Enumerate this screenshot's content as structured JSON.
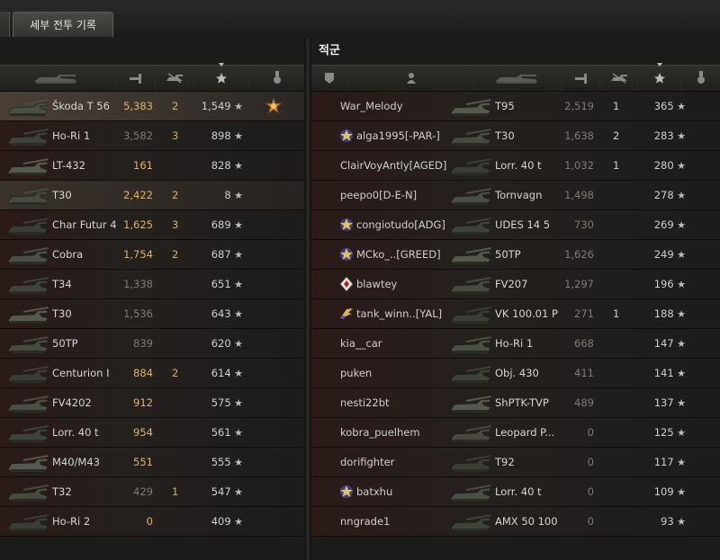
{
  "tab": {
    "label": "세부 전투 기록"
  },
  "enemy_title": "적군",
  "colors": {
    "xp": "#e0b46a",
    "dim": "#7c7c77",
    "text": "#d6d6d0"
  },
  "left_rows": [
    {
      "tank": "Škoda T 56",
      "xp": "5,383",
      "kills": "2",
      "score": "1,549",
      "xp_color": "gold",
      "medal": true,
      "hl": "hl"
    },
    {
      "tank": "Ho-Ri 1",
      "xp": "3,582",
      "kills": "3",
      "score": "898",
      "xp_color": "dim"
    },
    {
      "tank": "LT-432",
      "xp": "161",
      "kills": "",
      "score": "828",
      "xp_color": "gold"
    },
    {
      "tank": "T30",
      "xp": "2,422",
      "kills": "2",
      "score": "8",
      "xp_color": "gold",
      "hl": "hl2"
    },
    {
      "tank": "Char Futur 4",
      "xp": "1,625",
      "kills": "3",
      "score": "689",
      "xp_color": "gold"
    },
    {
      "tank": "Cobra",
      "xp": "1,754",
      "kills": "2",
      "score": "687",
      "xp_color": "gold"
    },
    {
      "tank": "T34",
      "xp": "1,338",
      "kills": "",
      "score": "651",
      "xp_color": "dim"
    },
    {
      "tank": "T30",
      "xp": "1,536",
      "kills": "",
      "score": "643",
      "xp_color": "dim"
    },
    {
      "tank": "50TP",
      "xp": "839",
      "kills": "",
      "score": "620",
      "xp_color": "dim"
    },
    {
      "tank": "Centurion I",
      "xp": "884",
      "kills": "2",
      "score": "614",
      "xp_color": "gold"
    },
    {
      "tank": "FV4202",
      "xp": "912",
      "kills": "",
      "score": "575",
      "xp_color": "gold"
    },
    {
      "tank": "Lorr. 40 t",
      "xp": "954",
      "kills": "",
      "score": "561",
      "xp_color": "gold"
    },
    {
      "tank": "M40/M43",
      "xp": "551",
      "kills": "",
      "score": "555",
      "xp_color": "gold"
    },
    {
      "tank": "T32",
      "xp": "429",
      "kills": "1",
      "score": "547",
      "xp_color": "dim"
    },
    {
      "tank": "Ho-Ri 2",
      "xp": "0",
      "kills": "",
      "score": "409",
      "xp_color": "gold"
    }
  ],
  "right_rows": [
    {
      "player": "War_Melody",
      "badge": "",
      "tank": "T95",
      "xp": "2,519",
      "kills": "1",
      "score": "365"
    },
    {
      "player": "alga1995[-PAR-]",
      "badge": "clan-badge",
      "tank": "T30",
      "xp": "1,638",
      "kills": "2",
      "score": "283"
    },
    {
      "player": "ClairVoyAntly[AGED]",
      "badge": "",
      "tank": "Lorr. 40 t",
      "xp": "1,032",
      "kills": "1",
      "score": "280"
    },
    {
      "player": "peepo0[D-E-N]",
      "badge": "",
      "tank": "Tornvagn",
      "xp": "1,498",
      "kills": "",
      "score": "278"
    },
    {
      "player": "congiotudo[ADG]",
      "badge": "clan-badge",
      "tank": "UDES 14 5",
      "xp": "730",
      "kills": "",
      "score": "269"
    },
    {
      "player": "MCko_..[GREED]",
      "badge": "clan-badge",
      "tank": "50TP",
      "xp": "1,626",
      "kills": "",
      "score": "249"
    },
    {
      "player": "blawtey",
      "badge": "rank-badge",
      "tank": "FV207",
      "xp": "1,297",
      "kills": "",
      "score": "196"
    },
    {
      "player": "tank_winn..[YAL]",
      "badge": "wing-badge",
      "tank": "VK 100.01 P",
      "xp": "271",
      "kills": "1",
      "score": "188"
    },
    {
      "player": "kia__car",
      "badge": "",
      "tank": "Ho-Ri 1",
      "xp": "668",
      "kills": "",
      "score": "147"
    },
    {
      "player": "puken",
      "badge": "",
      "tank": "Obj. 430",
      "xp": "411",
      "kills": "",
      "score": "141"
    },
    {
      "player": "nesti22bt",
      "badge": "",
      "tank": "ShPTK-TVP",
      "xp": "489",
      "kills": "",
      "score": "137"
    },
    {
      "player": "kobra_puelhem",
      "badge": "",
      "tank": "Leopard P...",
      "xp": "0",
      "kills": "",
      "score": "125"
    },
    {
      "player": "dorifighter",
      "badge": "",
      "tank": "T92",
      "xp": "0",
      "kills": "",
      "score": "117"
    },
    {
      "player": "batxhu",
      "badge": "clan-badge",
      "tank": "Lorr. 40 t",
      "xp": "0",
      "kills": "",
      "score": "109"
    },
    {
      "player": "nngrade1",
      "badge": "",
      "tank": "AMX 50 100",
      "xp": "0",
      "kills": "",
      "score": "93"
    }
  ],
  "star_glyph": "★"
}
